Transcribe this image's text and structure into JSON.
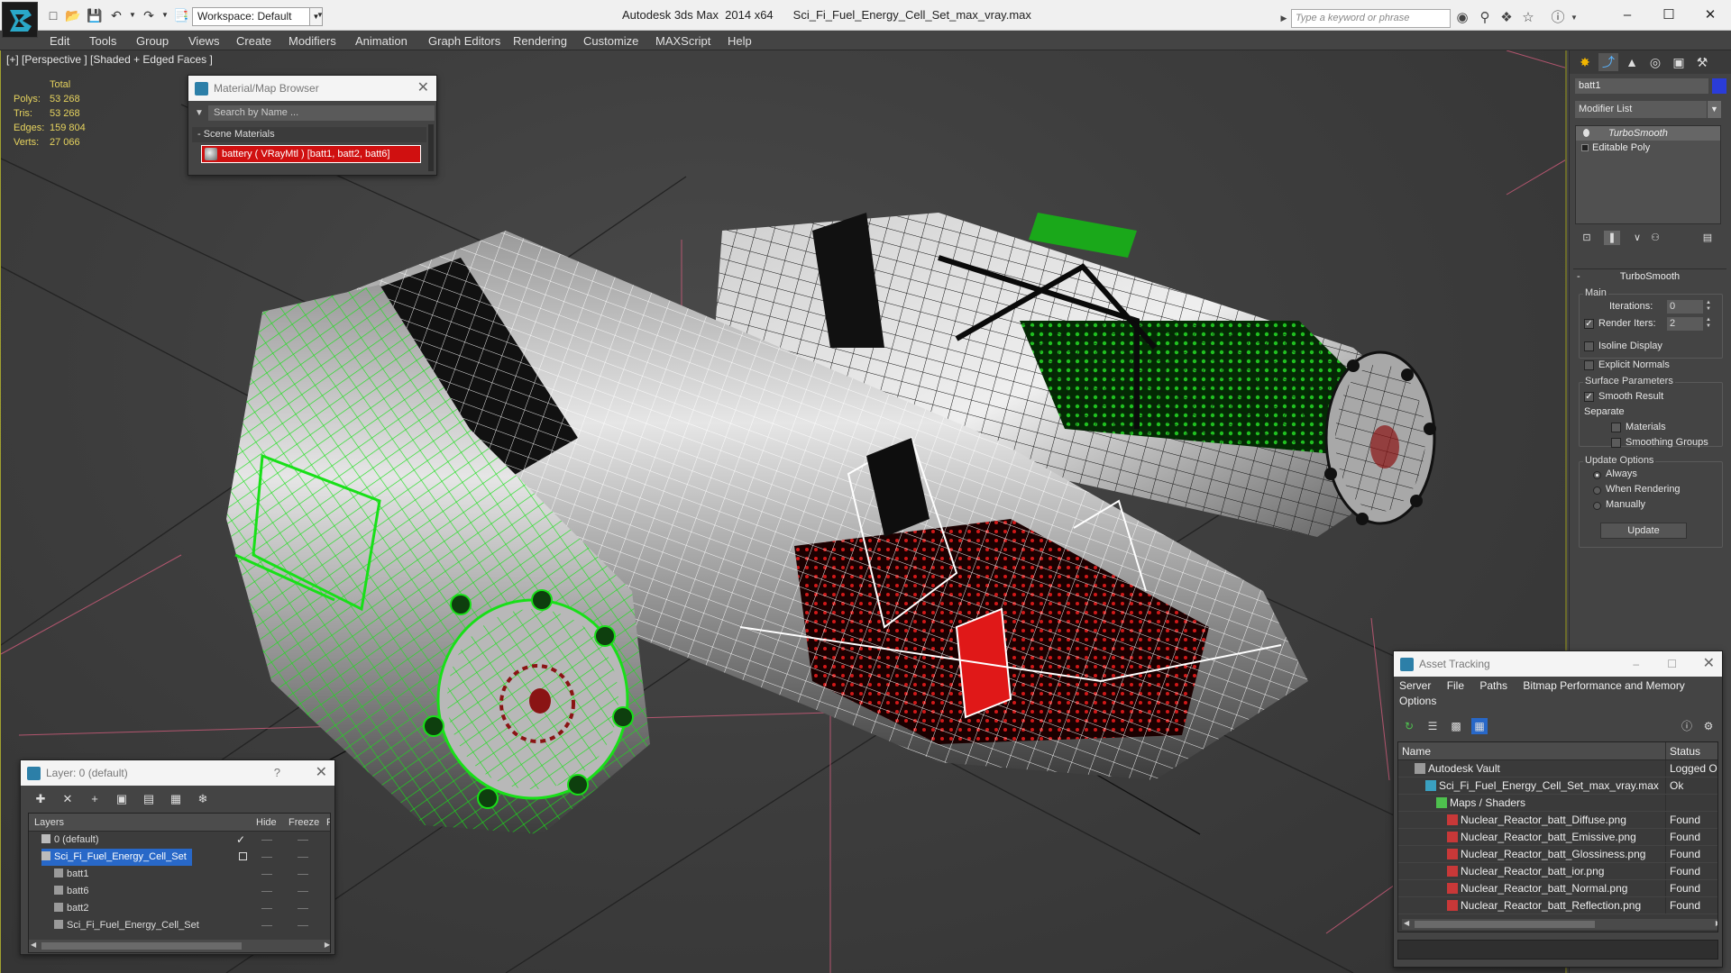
{
  "titlebar": {
    "app_title": "Autodesk 3ds Max  2014 x64",
    "file_name": "Sci_Fi_Fuel_Energy_Cell_Set_max_vray.max",
    "workspace": "Workspace: Default",
    "search_placeholder": "Type a keyword or phrase"
  },
  "menu": [
    "Edit",
    "Tools",
    "Group",
    "Views",
    "Create",
    "Modifiers",
    "Animation",
    "Graph Editors",
    "Rendering",
    "Customize",
    "MAXScript",
    "Help"
  ],
  "viewport": {
    "label": "[+] [Perspective ] [Shaded + Edged Faces ]",
    "stats": {
      "header": "Total",
      "rows": [
        {
          "label": "Polys:",
          "value": "53 268"
        },
        {
          "label": "Tris:",
          "value": "53 268"
        },
        {
          "label": "Edges:",
          "value": "159 804"
        },
        {
          "label": "Verts:",
          "value": "27 066"
        }
      ]
    }
  },
  "material_browser": {
    "title": "Material/Map Browser",
    "search_placeholder": "Search by Name ...",
    "section": "- Scene Materials",
    "item": "battery  ( VRayMtl ) [batt1, batt2, batt6]"
  },
  "command_panel": {
    "object_name": "batt1",
    "object_color": "#2a3cd8",
    "modifier_list": "Modifier List",
    "stack": [
      "TurboSmooth",
      "Editable Poly"
    ],
    "rollout_title": "TurboSmooth",
    "main_group": "Main",
    "iterations_label": "Iterations:",
    "iterations_value": "0",
    "render_iters_label": "Render Iters:",
    "render_iters_value": "2",
    "render_iters_checked": true,
    "isoline_label": "Isoline Display",
    "explicit_normals_label": "Explicit Normals",
    "surface_group": "Surface Parameters",
    "smooth_result_label": "Smooth Result",
    "separate_label": "Separate",
    "materials_label": "Materials",
    "smoothing_groups_label": "Smoothing Groups",
    "update_group": "Update Options",
    "update_options": [
      "Always",
      "When Rendering",
      "Manually"
    ],
    "update_selected": "Always",
    "update_button": "Update"
  },
  "asset_tracking": {
    "title": "Asset Tracking",
    "menu": [
      "Server",
      "File",
      "Paths",
      "Bitmap Performance and Memory"
    ],
    "menu_second_line": "Options",
    "columns": {
      "name": "Name",
      "status": "Status"
    },
    "rows": [
      {
        "name": "Autodesk Vault",
        "status": "Logged Ou",
        "indent": 1,
        "icon": "vault-icon"
      },
      {
        "name": "Sci_Fi_Fuel_Energy_Cell_Set_max_vray.max",
        "status": "Ok",
        "indent": 2,
        "icon": "max-file-icon"
      },
      {
        "name": "Maps / Shaders",
        "status": "",
        "indent": 3,
        "icon": "maps-folder-icon"
      },
      {
        "name": "Nuclear_Reactor_batt_Diffuse.png",
        "status": "Found",
        "indent": 4,
        "icon": "png-icon"
      },
      {
        "name": "Nuclear_Reactor_batt_Emissive.png",
        "status": "Found",
        "indent": 4,
        "icon": "png-icon"
      },
      {
        "name": "Nuclear_Reactor_batt_Glossiness.png",
        "status": "Found",
        "indent": 4,
        "icon": "png-icon"
      },
      {
        "name": "Nuclear_Reactor_batt_ior.png",
        "status": "Found",
        "indent": 4,
        "icon": "png-icon"
      },
      {
        "name": "Nuclear_Reactor_batt_Normal.png",
        "status": "Found",
        "indent": 4,
        "icon": "png-icon"
      },
      {
        "name": "Nuclear_Reactor_batt_Reflection.png",
        "status": "Found",
        "indent": 4,
        "icon": "png-icon"
      }
    ]
  },
  "layer_window": {
    "title": "Layer: 0 (default)",
    "help": "?",
    "columns": {
      "layers": "Layers",
      "hide": "Hide",
      "freeze": "Freeze",
      "r": "R"
    },
    "rows": [
      {
        "name": "0 (default)",
        "indent": 1,
        "selected": false,
        "active": true
      },
      {
        "name": "Sci_Fi_Fuel_Energy_Cell_Set",
        "indent": 1,
        "selected": true,
        "active": false
      },
      {
        "name": "batt1",
        "indent": 2,
        "selected": false,
        "active": false
      },
      {
        "name": "batt6",
        "indent": 2,
        "selected": false,
        "active": false
      },
      {
        "name": "batt2",
        "indent": 2,
        "selected": false,
        "active": false
      },
      {
        "name": "Sci_Fi_Fuel_Energy_Cell_Set",
        "indent": 2,
        "selected": false,
        "active": false
      }
    ]
  },
  "colors": {
    "stats_yellow": "#e6d35e",
    "selection_blue": "#2868c8",
    "material_red": "#d01010",
    "wire_green": "#18e018"
  }
}
